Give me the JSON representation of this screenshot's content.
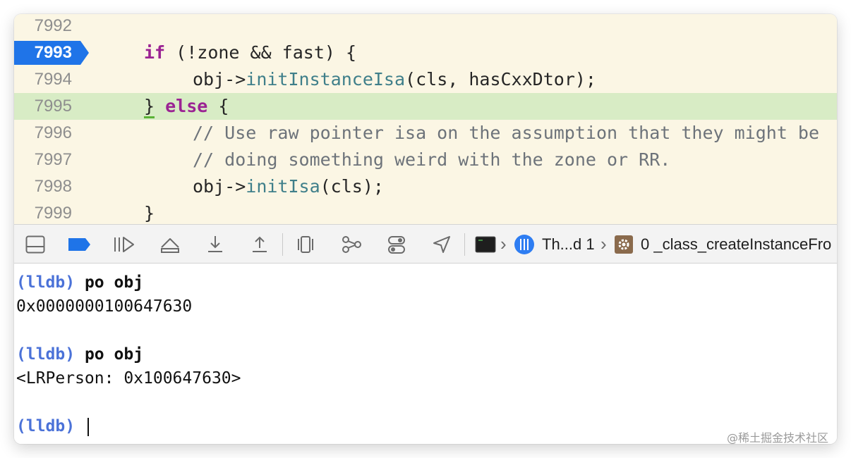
{
  "editor": {
    "lines": [
      {
        "num": "7992"
      },
      {
        "num": "7993",
        "kw1": "if",
        "rest": " (!zone && fast) {"
      },
      {
        "num": "7994",
        "pre": "obj->",
        "fn": "initInstanceIsa",
        "post": "(cls, hasCxxDtor);"
      },
      {
        "num": "7995",
        "brace": "}",
        "kw": "else",
        "post": " {"
      },
      {
        "num": "7996",
        "comment": "// Use raw pointer isa on the assumption that they might be"
      },
      {
        "num": "7997",
        "comment": "// doing something weird with the zone or RR."
      },
      {
        "num": "7998",
        "pre": "obj->",
        "fn": "initIsa",
        "post": "(cls);"
      },
      {
        "num": "7999",
        "brace": "}"
      }
    ],
    "breakpoint_line": "7993",
    "current_line": "7995",
    "colors": {
      "background": "#fbf6e4",
      "current_line": "#d8ecc5",
      "breakpoint": "#1f74e8",
      "keyword": "#9b2393",
      "function": "#3f7f8a",
      "comment": "#6d737a"
    }
  },
  "debug_bar": {
    "buttons": [
      {
        "icon": "hide-debug-area-icon"
      },
      {
        "icon": "breakpoints-toggle-icon"
      },
      {
        "icon": "continue-icon"
      },
      {
        "icon": "step-over-icon"
      },
      {
        "icon": "step-into-icon"
      },
      {
        "icon": "step-out-icon"
      },
      {
        "icon": "view-hierarchy-icon"
      },
      {
        "icon": "memory-graph-icon"
      },
      {
        "icon": "environment-overrides-icon"
      },
      {
        "icon": "simulate-location-icon"
      }
    ],
    "thread_label": "Th...d 1",
    "frame_label": "0 _class_createInstanceFro"
  },
  "console": {
    "entries": [
      {
        "prompt": "(lldb)",
        "command": "po obj"
      },
      {
        "output": "0x0000000100647630"
      },
      {
        "output": ""
      },
      {
        "prompt": "(lldb)",
        "command": "po obj"
      },
      {
        "output": "<LRPerson: 0x100647630>"
      },
      {
        "output": ""
      },
      {
        "prompt": "(lldb)",
        "command": ""
      }
    ]
  },
  "watermark": "@稀土掘金技术社区"
}
